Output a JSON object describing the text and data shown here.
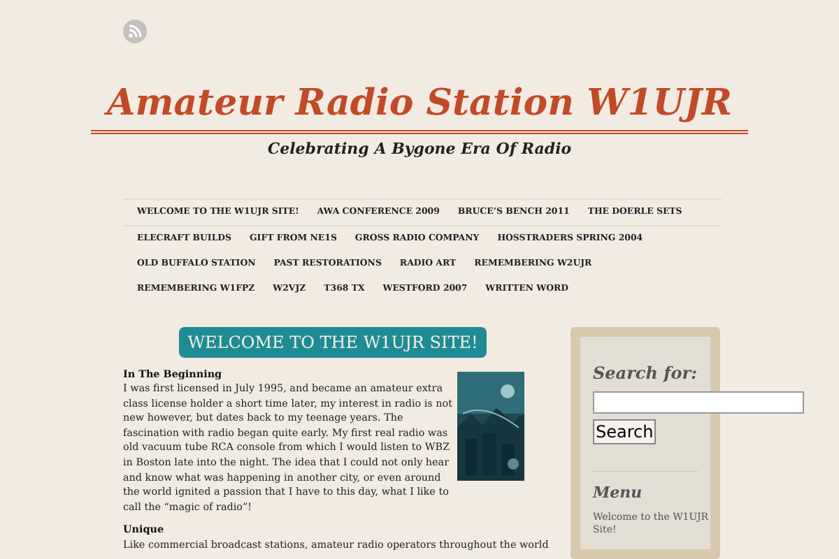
{
  "header": {
    "title": "Amateur Radio Station W1UJR",
    "tagline": "Celebrating A Bygone Era Of Radio"
  },
  "nav": [
    "WELCOME TO THE W1UJR SITE!",
    "AWA CONFERENCE 2009",
    "BRUCE’S BENCH 2011",
    "THE DOERLE SETS",
    "ELECRAFT BUILDS",
    "GIFT FROM NE1S",
    "GROSS RADIO COMPANY",
    "HOSSTRADERS SPRING 2004",
    "OLD BUFFALO STATION",
    "PAST RESTORATIONS",
    "RADIO ART",
    "REMEMBERING W2UJR",
    "REMEMBERING W1FPZ",
    "W2VJZ",
    "T368 TX",
    "WESTFORD 2007",
    "WRITTEN WORD"
  ],
  "main": {
    "heading": "WELCOME TO THE W1UJR SITE!",
    "sections": [
      {
        "title": "In The Beginning",
        "text": "I was first licensed in July 1995, and became an amateur extra class license holder a short time later, my interest in radio is not new however, but dates back to my teenage years. The fascination with radio began quite early. My first real radio was old vacuum tube RCA console from which I would listen to WBZ in Boston late into the night. The idea that I could not only hear and know what was happening in another city, or even around the world ignited a passion that I have to this day, what I like to call the “magic of radio”!"
      },
      {
        "title": "Unique",
        "text": "Like commercial broadcast stations, amateur radio operators throughout the world"
      }
    ]
  },
  "sidebar": {
    "search_label": "Search for:",
    "search_button": "Search",
    "menu_title": "Menu",
    "menu_items": [
      "Welcome to the W1UJR Site!"
    ]
  }
}
